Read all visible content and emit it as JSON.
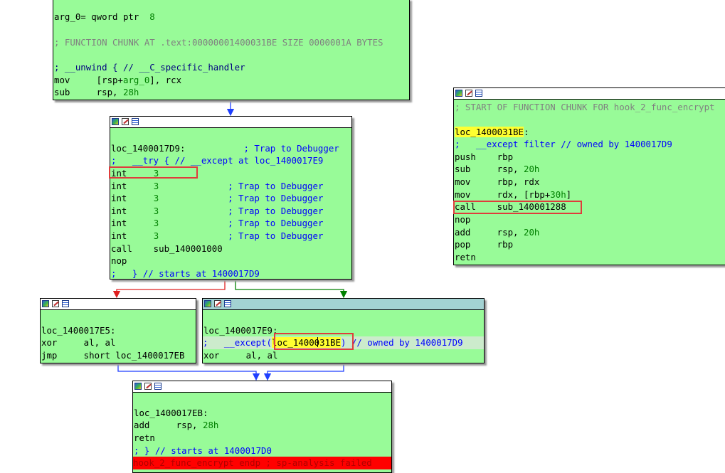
{
  "edges": {
    "colors": {
      "normal": "#1f3fff",
      "true_branch": "#008000",
      "false_branch": "#e02020"
    }
  },
  "block_entry": {
    "line0_a": "arg_0= qword ptr  ",
    "line0_b": "8",
    "line1": "; FUNCTION CHUNK AT .text:00000001400031BE SIZE 0000001A BYTES",
    "line2": "; __unwind { // __C_specific_handler",
    "line3_a": "mov     [rsp+",
    "line3_b": "arg_0",
    "line3_c": "], rcx",
    "line4_a": "sub     rsp, ",
    "line4_b": "28h"
  },
  "block_try": {
    "l1_a": "loc_1400017D9:",
    "l1_b": "           ; Trap to Debugger",
    "l2": ";   __try { // __except at loc_1400017E9",
    "int_mnemonic": "int     ",
    "int_operand": "3",
    "trap_comment": "             ; Trap to Debugger",
    "call_line": "call    sub_140001000",
    "nop_line": "nop",
    "end_line": ";   } // starts at 1400017D9"
  },
  "block_chunk": {
    "l0": "; START OF FUNCTION CHUNK FOR hook_2_func_encrypt",
    "l1_label": "loc_1400031BE",
    "l1_colon": ":",
    "l2": ";   __except filter // owned by 1400017D9",
    "l3": "push    rbp",
    "l4_a": "sub     rsp, ",
    "l4_b": "20h",
    "l5": "mov     rbp, rdx",
    "l6_a": "mov     rdx, [rbp+",
    "l6_b": "30h",
    "l6_c": "]",
    "l7": "call    sub_140001288",
    "l8": "nop",
    "l9_a": "add     rsp, ",
    "l9_b": "20h",
    "l10": "pop     rbp",
    "l11": "retn"
  },
  "block_e5": {
    "l1": "loc_1400017E5:",
    "l2": "xor     al, al",
    "l3": "jmp     short loc_1400017EB"
  },
  "block_e9": {
    "l1": "loc_1400017E9:",
    "l2_a": ";   __except(",
    "l2_b": "loc_1400031BE",
    "l2_c": ") // owned by 1400017D9",
    "l3": "xor     al, al"
  },
  "block_eb": {
    "l1": "loc_1400017EB:",
    "l2_a": "add     rsp, ",
    "l2_b": "28h",
    "l3": "retn",
    "l4": "; } // starts at 1400017D0",
    "l5": "hook_2_func_encrypt endp ; sp-analysis failed"
  }
}
